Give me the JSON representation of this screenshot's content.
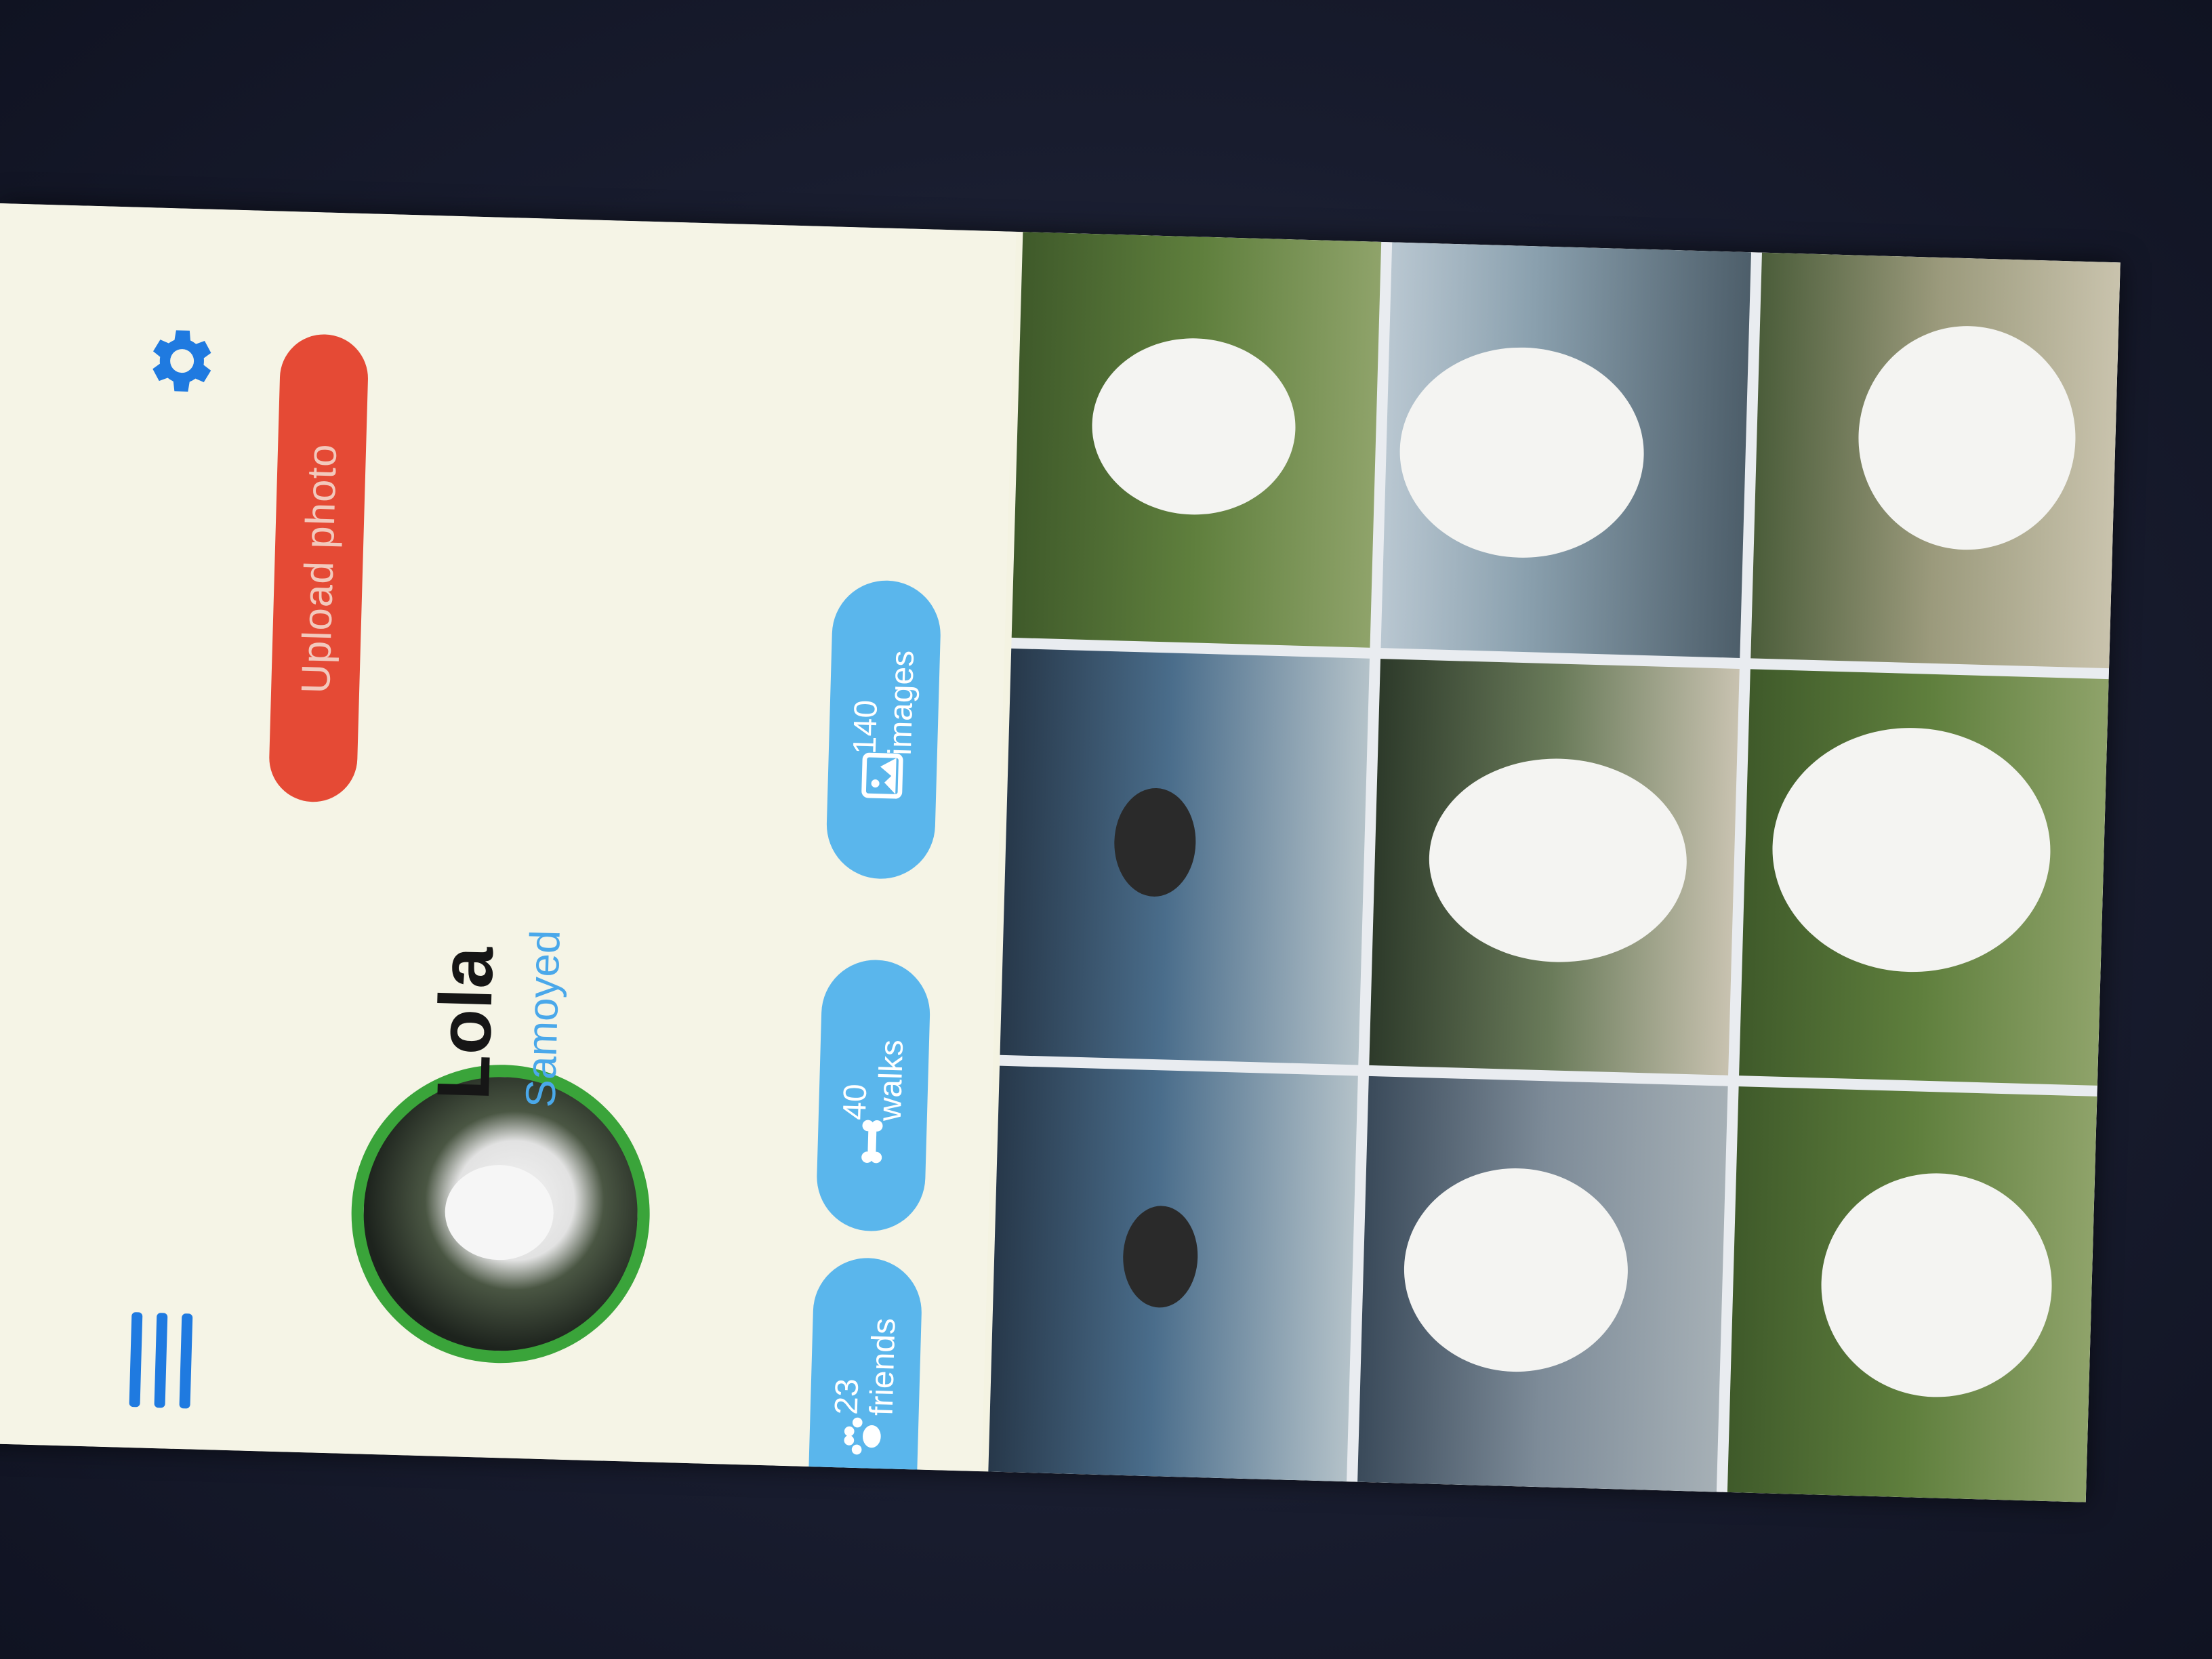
{
  "app": {
    "menu_icon": "hamburger-menu-icon",
    "settings_icon": "gear-icon"
  },
  "profile": {
    "name": "Lola",
    "breed": "Samoyed",
    "upload_label": "Upload photo"
  },
  "stats": [
    {
      "icon": "paw-icon",
      "count": "23",
      "label": "friends"
    },
    {
      "icon": "bone-icon",
      "count": "40",
      "label": "walks"
    },
    {
      "icon": "image-icon",
      "count": "140",
      "label": "images"
    }
  ],
  "colors": {
    "accent_blue": "#1f7ae0",
    "stat_pill": "#5ab6ec",
    "upload_button": "#e54a35",
    "avatar_ring": "#3aa43a"
  },
  "gallery": {
    "photo_count": 9
  }
}
